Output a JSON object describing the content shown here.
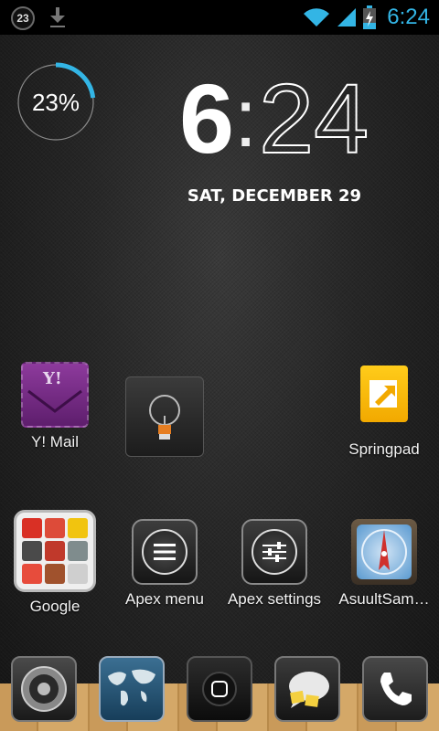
{
  "status_bar": {
    "notification_count": "23",
    "time": "6:24",
    "icons": [
      "notification-badge-icon",
      "download-icon",
      "wifi-icon",
      "signal-icon",
      "battery-charging-icon"
    ],
    "accent_color": "#33b5e5"
  },
  "battery_widget": {
    "percent_label": "23%",
    "level_fraction": 0.23,
    "ring_color": "#33b5e5"
  },
  "clock": {
    "hour": "6",
    "separator": ":",
    "minutes": "24",
    "date": "SAT, DECEMBER 29"
  },
  "home_row1": [
    {
      "label": "Y! Mail",
      "icon": "yahoo-mail-icon"
    },
    {
      "label": "",
      "icon": "flashlight-icon"
    },
    {
      "label": "Springpad",
      "icon": "springpad-icon"
    }
  ],
  "home_row2": [
    {
      "label": "Google",
      "icon": "google-folder-icon"
    },
    {
      "label": "Apex menu",
      "icon": "apex-menu-icon"
    },
    {
      "label": "Apex settings",
      "icon": "apex-settings-icon"
    },
    {
      "label": "AsuultSam…",
      "icon": "compass-app-icon"
    }
  ],
  "dock": [
    {
      "icon": "speaker-icon"
    },
    {
      "icon": "world-map-icon"
    },
    {
      "icon": "app-drawer-icon"
    },
    {
      "icon": "messaging-icon"
    },
    {
      "icon": "phone-icon"
    }
  ]
}
